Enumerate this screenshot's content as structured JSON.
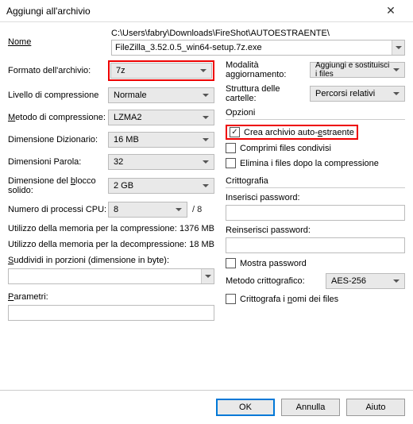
{
  "window": {
    "title": "Aggiungi all'archivio"
  },
  "name": {
    "label": "Nome",
    "path": "C:\\Users\\fabry\\Downloads\\FireShot\\AUTOESTRAENTE\\",
    "filename": "FileZilla_3.52.0.5_win64-setup.7z.exe"
  },
  "left": {
    "format": {
      "label": "Formato dell'archivio:",
      "value": "7z"
    },
    "level": {
      "label": "Livello di compressione",
      "value": "Normale"
    },
    "method": {
      "label": "Metodo di compressione:",
      "value": "LZMA2"
    },
    "dict": {
      "label": "Dimensione Dizionario:",
      "value": "16 MB"
    },
    "word": {
      "label": "Dimensioni Parola:",
      "value": "32"
    },
    "block": {
      "label": "Dimensione del blocco solido:",
      "value": "2 GB"
    },
    "cpu": {
      "label": "Numero di processi CPU:",
      "value": "8",
      "total": "/ 8"
    },
    "mem_comp": {
      "label": "Utilizzo della memoria per la compressione:",
      "value": "1376 MB"
    },
    "mem_decomp": {
      "label": "Utilizzo della memoria per la decompressione:",
      "value": "18 MB"
    },
    "split": {
      "label": "Suddividi in porzioni (dimensione in byte):"
    },
    "params": {
      "label": "Parametri:"
    }
  },
  "right": {
    "updatemode": {
      "label": "Modalità aggiornamento:",
      "value": "Aggiungi e sostituisci i files"
    },
    "pathmode": {
      "label": "Struttura delle cartelle:",
      "value": "Percorsi relativi"
    },
    "options": {
      "title": "Opzioni",
      "sfx": "Crea archivio auto-estraente",
      "shared": "Comprimi files condivisi",
      "delete": "Elimina i files dopo la compressione"
    },
    "crypt": {
      "title": "Crittografia",
      "pass1": "Inserisci password:",
      "pass2": "Reinserisci password:",
      "showpass": "Mostra password",
      "method_label": "Metodo crittografico:",
      "method_value": "AES-256",
      "encnames": "Crittografa i nomi dei files"
    }
  },
  "buttons": {
    "ok": "OK",
    "cancel": "Annulla",
    "help": "Aiuto"
  }
}
